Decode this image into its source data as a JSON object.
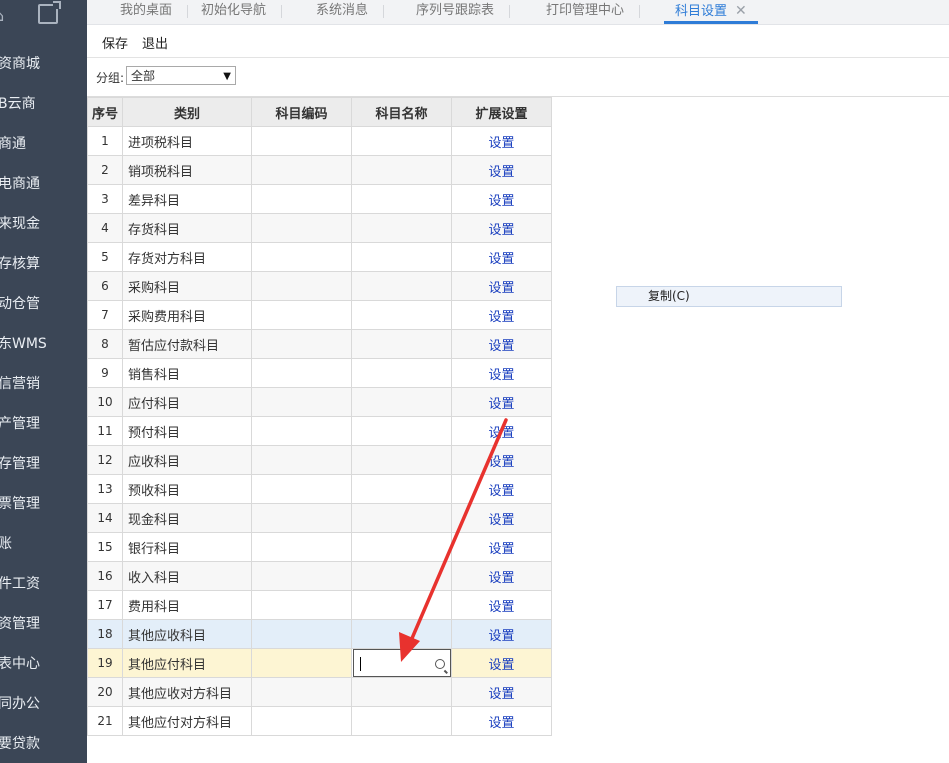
{
  "sidebar": {
    "items": [
      "资商城",
      "B云商",
      "商通",
      "电商通",
      "来现金",
      "存核算",
      "动仓管",
      "东WMS",
      "信营销",
      "产管理",
      "存管理",
      "票管理",
      "账",
      "件工资",
      "资管理",
      "表中心",
      "同办公",
      "要贷款"
    ]
  },
  "tabs": [
    {
      "label": "我的桌面",
      "active": false
    },
    {
      "label": "初始化导航",
      "active": false
    },
    {
      "label": "系统消息",
      "active": false
    },
    {
      "label": "序列号跟踪表",
      "active": false
    },
    {
      "label": "打印管理中心",
      "active": false
    },
    {
      "label": "科目设置",
      "active": true,
      "close": "✕"
    }
  ],
  "toolbar": {
    "save_label": "保存",
    "exit_label": "退出"
  },
  "filter": {
    "label": "分组:",
    "value": "全部",
    "arrow": "▼"
  },
  "table": {
    "headers": {
      "seq": "序号",
      "category": "类别",
      "code": "科目编码",
      "name": "科目名称",
      "ext": "扩展设置"
    },
    "link_label": "设置",
    "rows": [
      {
        "seq": "1",
        "category": "进项税科目"
      },
      {
        "seq": "2",
        "category": "销项税科目"
      },
      {
        "seq": "3",
        "category": "差异科目"
      },
      {
        "seq": "4",
        "category": "存货科目"
      },
      {
        "seq": "5",
        "category": "存货对方科目"
      },
      {
        "seq": "6",
        "category": "采购科目"
      },
      {
        "seq": "7",
        "category": "采购费用科目"
      },
      {
        "seq": "8",
        "category": "暂估应付款科目"
      },
      {
        "seq": "9",
        "category": "销售科目"
      },
      {
        "seq": "10",
        "category": "应付科目"
      },
      {
        "seq": "11",
        "category": "预付科目"
      },
      {
        "seq": "12",
        "category": "应收科目"
      },
      {
        "seq": "13",
        "category": "预收科目"
      },
      {
        "seq": "14",
        "category": "现金科目"
      },
      {
        "seq": "15",
        "category": "银行科目"
      },
      {
        "seq": "16",
        "category": "收入科目"
      },
      {
        "seq": "17",
        "category": "费用科目"
      },
      {
        "seq": "18",
        "category": "其他应收科目"
      },
      {
        "seq": "19",
        "category": "其他应付科目"
      },
      {
        "seq": "20",
        "category": "其他应收对方科目"
      },
      {
        "seq": "21",
        "category": "其他应付对方科目"
      }
    ]
  },
  "context_menu": {
    "items": [
      "复制(C)"
    ]
  },
  "colors": {
    "sidebar_bg": "#3b4656",
    "accent": "#2e7cd7",
    "link": "#1a3fbf",
    "arrow": "#e8322e",
    "row_selected": "#e3eef9",
    "row_editing": "#fdf5d3"
  }
}
